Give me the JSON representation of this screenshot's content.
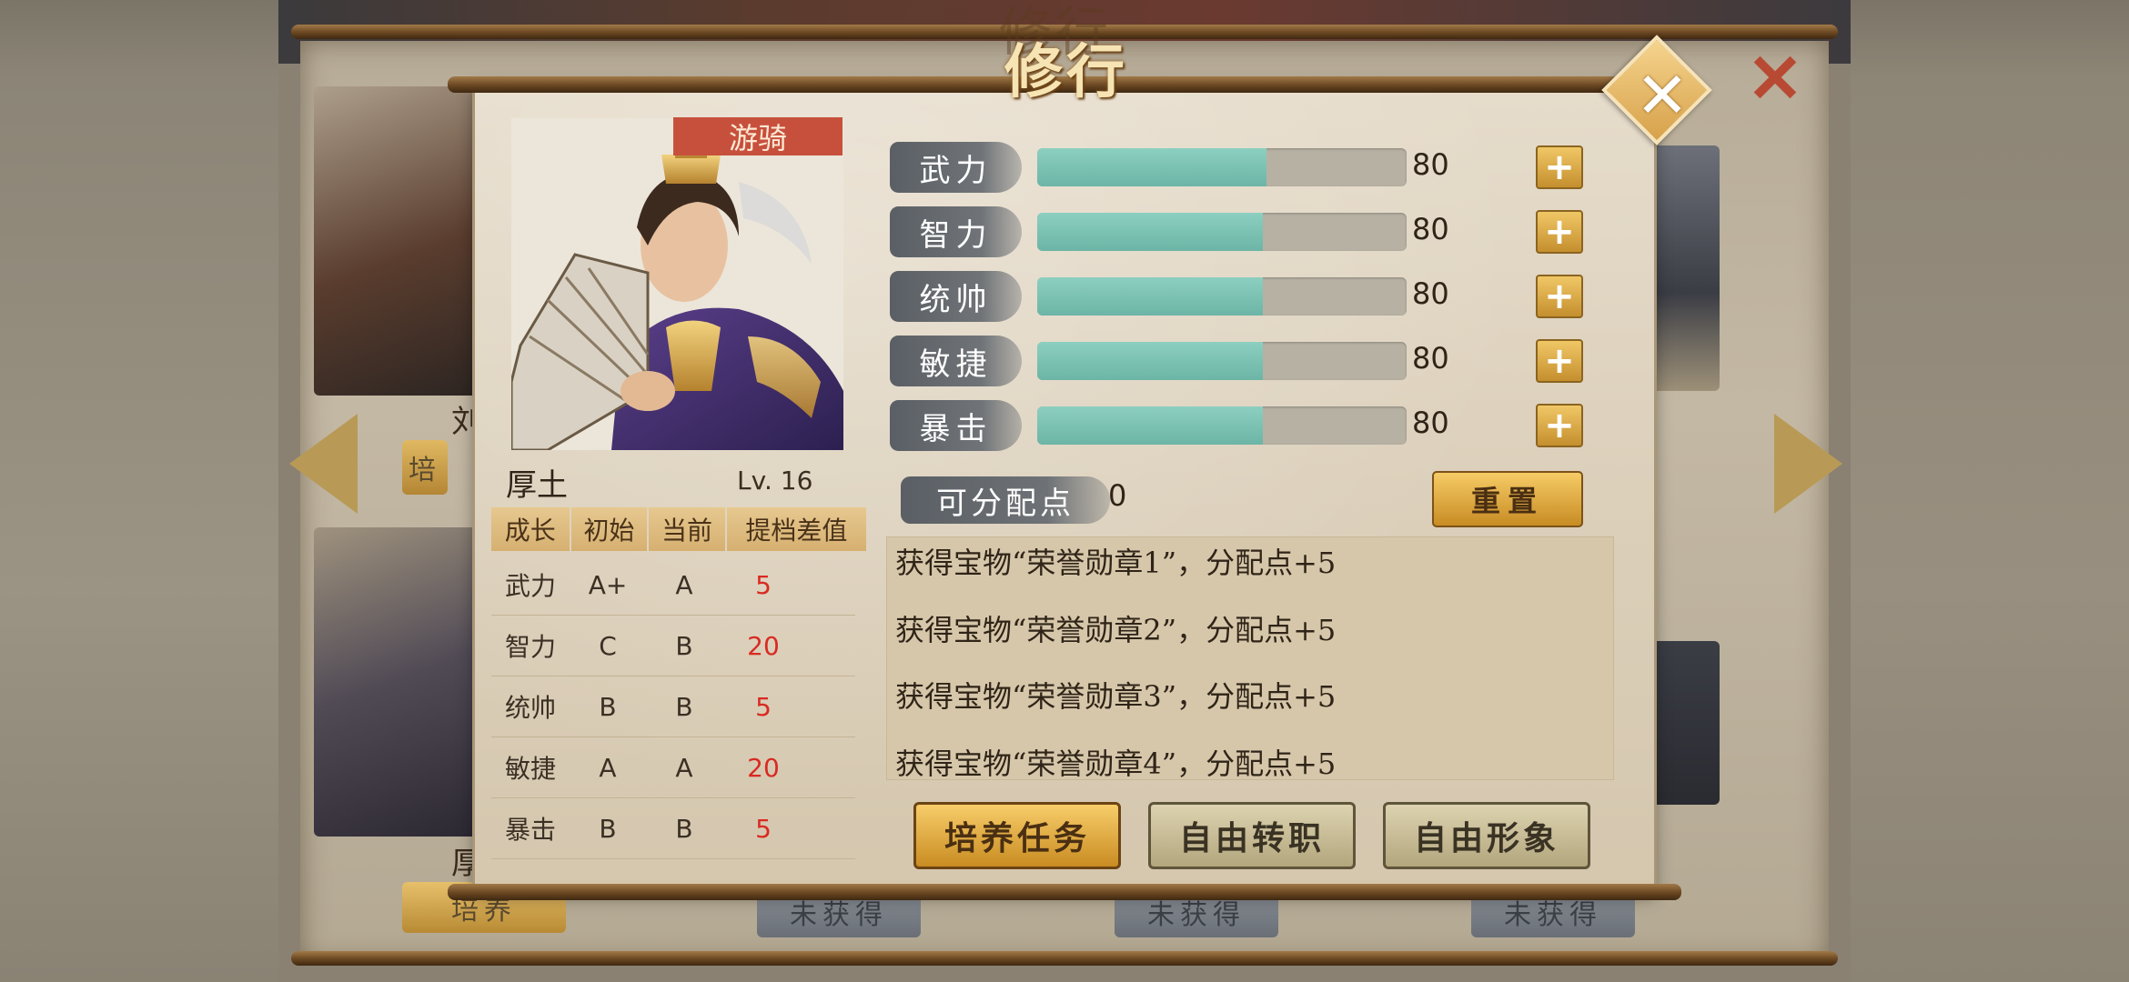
{
  "dialog": {
    "title": "修行",
    "hero": {
      "class_badge": "游骑",
      "name": "厚土",
      "level": "Lv. 16"
    },
    "growth_table": {
      "headers": [
        "成长",
        "初始",
        "当前",
        "提档差值"
      ],
      "rows": [
        {
          "stat": "武力",
          "initial": "A+",
          "current": "A",
          "diff": "5"
        },
        {
          "stat": "智力",
          "initial": "C",
          "current": "B",
          "diff": "20"
        },
        {
          "stat": "统帅",
          "initial": "B",
          "current": "B",
          "diff": "5"
        },
        {
          "stat": "敏捷",
          "initial": "A",
          "current": "A",
          "diff": "20"
        },
        {
          "stat": "暴击",
          "initial": "B",
          "current": "B",
          "diff": "5"
        }
      ]
    },
    "attributes": [
      {
        "label": "武力",
        "value": "80",
        "fill_fraction": 0.62
      },
      {
        "label": "智力",
        "value": "80",
        "fill_fraction": 0.61
      },
      {
        "label": "统帅",
        "value": "80",
        "fill_fraction": 0.61
      },
      {
        "label": "敏捷",
        "value": "80",
        "fill_fraction": 0.61
      },
      {
        "label": "暴击",
        "value": "80",
        "fill_fraction": 0.61
      }
    ],
    "plus_label": "+",
    "points": {
      "label": "可分配点",
      "value": "0"
    },
    "reset_label": "重置",
    "log": [
      "获得宝物“荣誉勋章1”，分配点+5",
      "获得宝物“荣誉勋章2”，分配点+5",
      "获得宝物“荣誉勋章3”，分配点+5",
      "获得宝物“荣誉勋章4”，分配点+5"
    ],
    "buttons": {
      "train": "培养任务",
      "job": "自由转职",
      "look": "自由形象"
    }
  },
  "background": {
    "title_shadow": "修行",
    "card_names": [
      "刘",
      "厚"
    ],
    "button_labels": [
      "培养",
      "未获得",
      "未获得",
      "未获得",
      "培"
    ],
    "close_label": "✕"
  },
  "colors": {
    "bar_fill": "#7cc2b3",
    "badge": "#c7503d",
    "gold_button": "#e0a83e",
    "diff_red": "#d92a22"
  },
  "icons": [
    "close-icon",
    "arrow-left-icon",
    "arrow-right-icon",
    "plus-icon"
  ]
}
